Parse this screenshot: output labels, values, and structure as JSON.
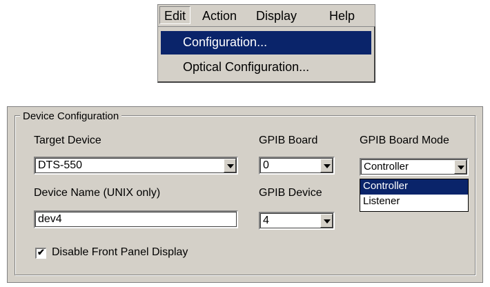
{
  "menubar": {
    "items": [
      "Edit",
      "Action",
      "Display",
      "Help"
    ]
  },
  "edit_menu": {
    "items": [
      "Configuration...",
      "Optical Configuration..."
    ]
  },
  "device_config": {
    "legend": "Device Configuration",
    "target_device": {
      "label": "Target Device",
      "value": "DTS-550"
    },
    "gpib_board": {
      "label": "GPIB Board",
      "value": "0"
    },
    "gpib_board_mode": {
      "label": "GPIB Board Mode",
      "value": "Controller",
      "options": [
        "Controller",
        "Listener"
      ],
      "selected_option": "Controller"
    },
    "device_name": {
      "label": "Device Name (UNIX only)",
      "value": "dev4"
    },
    "gpib_device": {
      "label": "GPIB Device",
      "value": "4"
    },
    "disable_front_panel": {
      "label": "Disable Front Panel Display",
      "checked": true
    }
  }
}
